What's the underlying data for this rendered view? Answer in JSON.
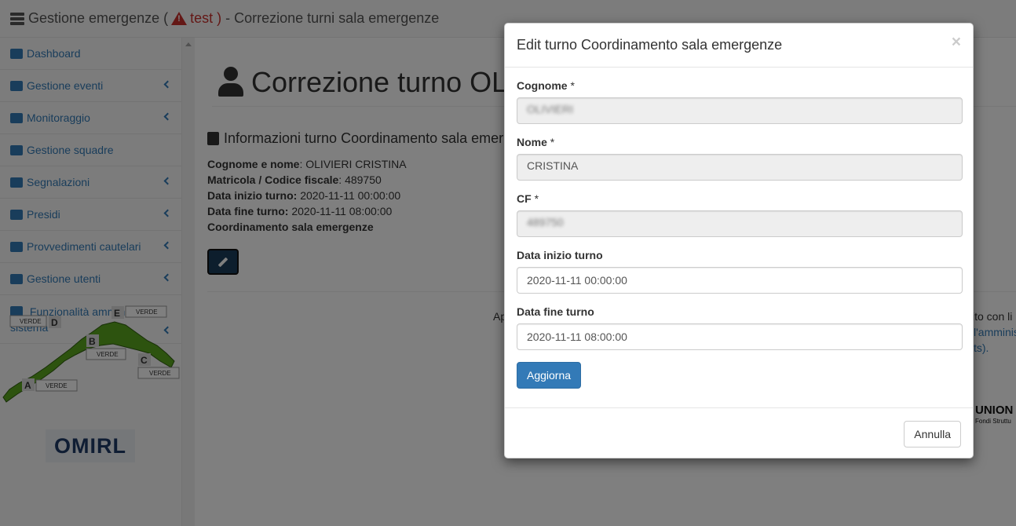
{
  "header": {
    "app_title": "Gestione emergenze (",
    "env_label": "test )",
    "separator_title": "- Correzione turni sala emergenze"
  },
  "sidebar": {
    "items": [
      {
        "label": "Dashboard",
        "icon": "dashboard-icon",
        "has_submenu": false
      },
      {
        "label": "Gestione eventi",
        "icon": "list-icon",
        "has_submenu": true
      },
      {
        "label": "Monitoraggio",
        "icon": "cloud-rain-icon",
        "has_submenu": true
      },
      {
        "label": "Gestione squadre",
        "icon": "users-icon",
        "has_submenu": false
      },
      {
        "label": "Segnalazioni",
        "icon": "map-marker-icon",
        "has_submenu": true
      },
      {
        "label": "Presidi",
        "icon": "tools-icon",
        "has_submenu": true
      },
      {
        "label": "Provvedimenti cautelari",
        "icon": "warning-icon",
        "has_submenu": true
      },
      {
        "label": "Gestione utenti",
        "icon": "id-card-icon",
        "has_submenu": true
      },
      {
        "label": "Funzionalità amministratore sistema",
        "icon": "user-gear-icon",
        "has_submenu": true
      }
    ],
    "map": {
      "zones": [
        {
          "letter": "A",
          "status": "VERDE"
        },
        {
          "letter": "B",
          "status": "VERDE"
        },
        {
          "letter": "C",
          "status": "VERDE"
        },
        {
          "letter": "D",
          "status": "VERDE"
        },
        {
          "letter": "E",
          "status": "VERDE"
        }
      ],
      "color": "#5aa61e"
    },
    "omirl_logo": "OMIRL"
  },
  "main": {
    "page_title": "Correzione turno OL",
    "section_title": "Informazioni turno Coordinamento sala emer",
    "info": {
      "name_label": "Cognome e nome",
      "name_value": ": OLIVIERI CRISTINA",
      "matricola_label": "Matricola / Codice fiscale",
      "matricola_value": ": 489750",
      "start_label": "Data inizio turno:",
      "start_value": " 2020-11-11 00:00:00",
      "end_label": "Data fine turno:",
      "end_value": " 2020-11-11 08:00:00",
      "role": "Coordinamento sala emergenze"
    },
    "footer_fragments": {
      "left": "Ap",
      "right_1": "ito con li",
      "right_2": "l'amminis",
      "right_3": "ts).",
      "union": "UNION",
      "union_sub": "Fondi Struttu"
    }
  },
  "modal": {
    "title": "Edit turno Coordinamento sala emergenze",
    "close": "×",
    "fields": {
      "cognome": {
        "label": "Cognome",
        "required": "*",
        "value": "OLIVIERI"
      },
      "nome": {
        "label": "Nome",
        "required": "*",
        "value": "CRISTINA"
      },
      "cf": {
        "label": "CF",
        "required": "*",
        "value": "489750"
      },
      "start": {
        "label": "Data inizio turno",
        "value": "2020-11-11 00:00:00"
      },
      "end": {
        "label": "Data fine turno",
        "value": "2020-11-11 08:00:00"
      }
    },
    "submit_label": "Aggiorna",
    "cancel_label": "Annulla"
  },
  "colors": {
    "primary": "#337ab7",
    "danger": "#c9302c",
    "backdrop": "rgba(0,0,0,0.5)"
  }
}
